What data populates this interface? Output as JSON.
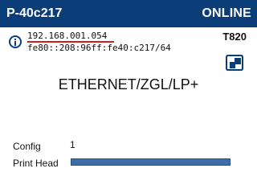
{
  "header": {
    "device_name": "P-40c217",
    "status": "ONLINE",
    "background_color": "#0b3d78"
  },
  "network": {
    "info_icon": "info-icon",
    "ipv4": "192.168.001.054",
    "ipv6": "fe80::208:96ff:fe40:c217/64",
    "ipv4_underline_color": "#cc1f1f"
  },
  "printer": {
    "model": "T820",
    "device_icon": "printer-device-icon",
    "protocol": "ETHERNET/ZGL/LP+"
  },
  "stats": {
    "config_label": "Config",
    "config_value": "1",
    "print_head_label": "Print Head",
    "print_head_level": 1.0,
    "meter_color": "#3d6ea8"
  }
}
